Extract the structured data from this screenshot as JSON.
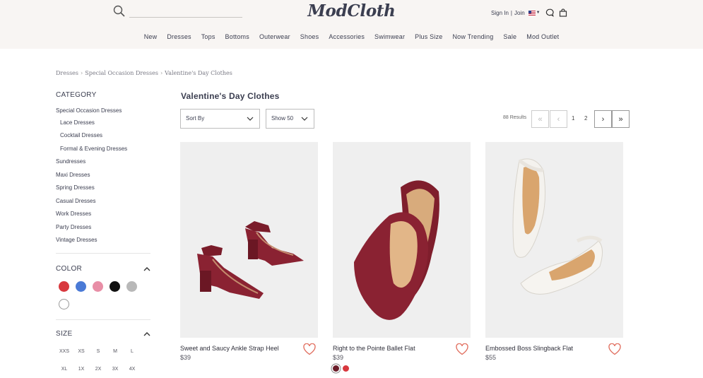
{
  "header": {
    "logo": "ModCloth",
    "sign_in": "Sign In",
    "separator": "|",
    "join": "Join",
    "search_placeholder": "",
    "nav": [
      "New",
      "Dresses",
      "Tops",
      "Bottoms",
      "Outerwear",
      "Shoes",
      "Accessories",
      "Swimwear",
      "Plus Size",
      "Now Trending",
      "Sale",
      "Mod Outlet"
    ]
  },
  "breadcrumb": [
    "Dresses",
    "Special Occasion Dresses",
    "Valentine's Day Clothes"
  ],
  "breadcrumb_sep": "›",
  "sidebar": {
    "category_heading": "CATEGORY",
    "categories": [
      {
        "label": "Special Occasion Dresses",
        "sub": false
      },
      {
        "label": "Lace Dresses",
        "sub": true
      },
      {
        "label": "Cocktail Dresses",
        "sub": true
      },
      {
        "label": "Formal & Evening Dresses",
        "sub": true
      },
      {
        "label": "Sundresses",
        "sub": false
      },
      {
        "label": "Maxi Dresses",
        "sub": false
      },
      {
        "label": "Spring Dresses",
        "sub": false
      },
      {
        "label": "Casual Dresses",
        "sub": false
      },
      {
        "label": "Work Dresses",
        "sub": false
      },
      {
        "label": "Party Dresses",
        "sub": false
      },
      {
        "label": "Vintage Dresses",
        "sub": false
      }
    ],
    "color_heading": "COLOR",
    "colors": [
      "#d8383e",
      "#4a7ad6",
      "#e88ea6",
      "#111111",
      "#b8b8b8",
      "#ffffff"
    ],
    "size_heading": "SIZE",
    "sizes": [
      "XXS",
      "XS",
      "S",
      "M",
      "L",
      "XL",
      "1X",
      "2X",
      "3X",
      "4X"
    ]
  },
  "main": {
    "title": "Valentine's Day Clothes",
    "sort_label": "Sort By",
    "show_label": "Show 50",
    "results": "88 Results",
    "pages": [
      "1",
      "2"
    ],
    "products": [
      {
        "name": "Sweet and Saucy Ankle Strap Heel",
        "price": "$39",
        "swatches": []
      },
      {
        "name": "Right to the Pointe Ballet Flat",
        "price": "$39",
        "swatches": [
          "#6b1e2a",
          "#d8383e"
        ]
      },
      {
        "name": "Embossed Boss Slingback Flat",
        "price": "$55",
        "swatches": []
      }
    ]
  },
  "colors": {
    "header_bg": "#f8f5f3",
    "heart": "#e06a5a",
    "text": "#3b3e50"
  }
}
